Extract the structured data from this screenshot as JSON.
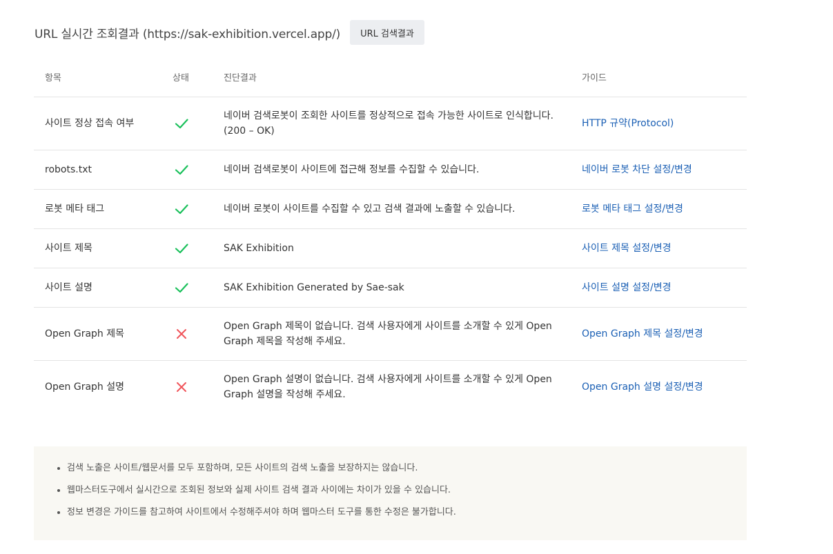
{
  "header": {
    "title": "URL 실시간 조회결과 (https://sak-exhibition.vercel.app/)",
    "button_label": "URL 검색결과"
  },
  "table": {
    "columns": [
      "항목",
      "상태",
      "진단결과",
      "가이드"
    ],
    "rows": [
      {
        "item": "사이트 정상 접속 여부",
        "status": "pass",
        "result": "네이버 검색로봇이 조회한 사이트를 정상적으로 접속 가능한 사이트로 인식합니다. (200 – OK)",
        "guide": "HTTP 규약(Protocol)"
      },
      {
        "item": "robots.txt",
        "status": "pass",
        "result": "네이버 검색로봇이 사이트에 접근해 정보를 수집할 수 있습니다.",
        "guide": "네이버 로봇 차단 설정/변경"
      },
      {
        "item": "로봇 메타 태그",
        "status": "pass",
        "result": "네이버 로봇이 사이트를 수집할 수 있고 검색 결과에 노출할 수 있습니다.",
        "guide": "로봇 메타 태그 설정/변경"
      },
      {
        "item": "사이트 제목",
        "status": "pass",
        "result": "SAK Exhibition",
        "guide": "사이트 제목 설정/변경"
      },
      {
        "item": "사이트 설명",
        "status": "pass",
        "result": "SAK Exhibition Generated by Sae-sak",
        "guide": "사이트 설명 설정/변경"
      },
      {
        "item": "Open Graph 제목",
        "status": "fail",
        "result": "Open Graph 제목이 없습니다. 검색 사용자에게 사이트를 소개할 수 있게 Open Graph 제목을 작성해 주세요.",
        "guide": "Open Graph 제목 설정/변경"
      },
      {
        "item": "Open Graph 설명",
        "status": "fail",
        "result": "Open Graph 설명이 없습니다. 검색 사용자에게 사이트를 소개할 수 있게 Open Graph 설명을 작성해 주세요.",
        "guide": "Open Graph 설명 설정/변경"
      }
    ]
  },
  "notes": [
    "검색 노출은 사이트/웹문서를 모두 포함하며, 모든 사이트의 검색 노출을 보장하지는 않습니다.",
    "웹마스터도구에서 실시간으로 조회된 정보와 실제 사이트 검색 결과 사이에는 차이가 있을 수 있습니다.",
    "정보 변경은 가이드를 참고하여 사이트에서 수정해주셔야 하며 웹마스터 도구를 통한 수정은 불가합니다."
  ],
  "icons": {
    "pass": "check-icon",
    "fail": "x-icon"
  },
  "colors": {
    "pass": "#19c05a",
    "fail": "#f0545a",
    "link": "#1a5fb4",
    "notes_background": "#f9f8f3"
  }
}
